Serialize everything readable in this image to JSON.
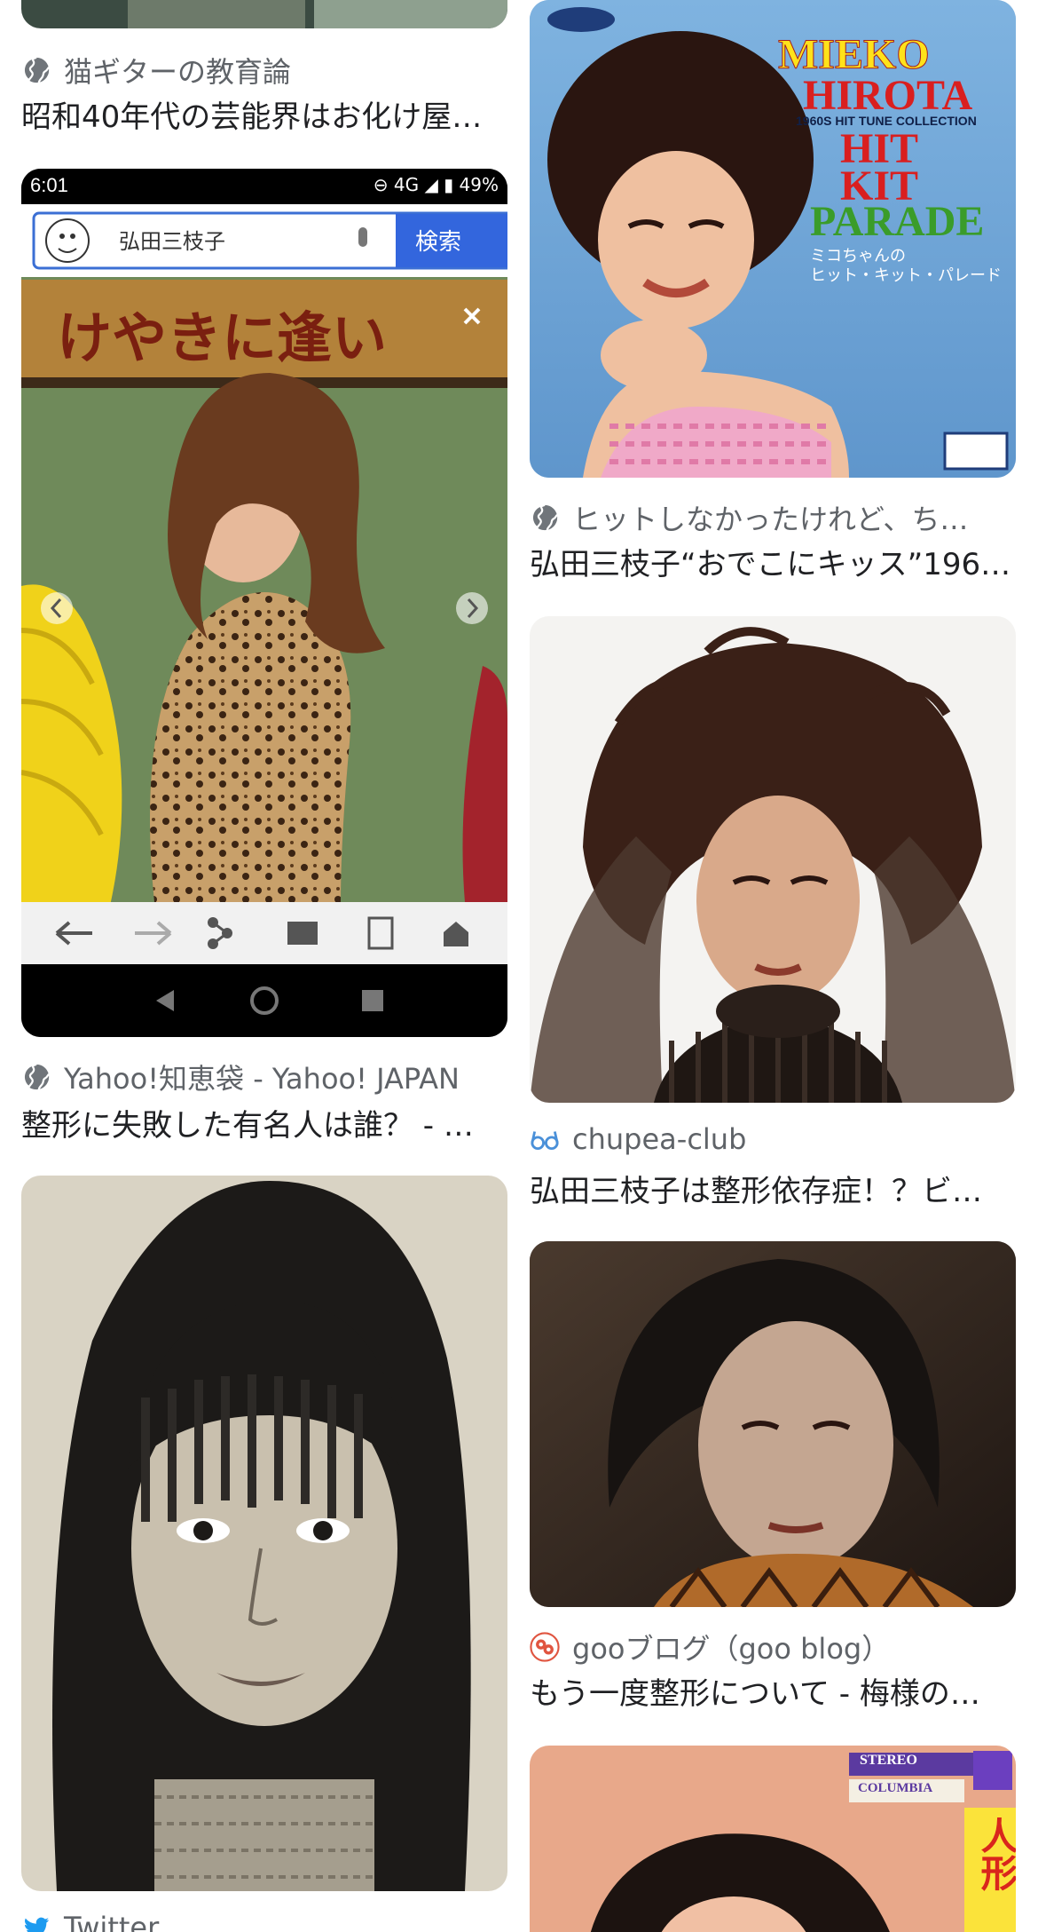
{
  "results": [
    {
      "source": "猫ギターの教育論",
      "title": "昭和40年代の芸能界はお化け屋…"
    },
    {
      "source": "Yahoo!知恵袋 - Yahoo! JAPAN",
      "title": "整形に失敗した有名人は誰？ - …",
      "embedded_ui": {
        "time": "6:01",
        "status_right": "⊖ 4G ◢ ▮ 49%",
        "search_query": "弘田三枝子",
        "search_button": "検索",
        "banner_text": "けやきに逢い"
      }
    },
    {
      "source": "Twitter",
      "title": ""
    },
    {
      "source": "ヒットしなかったけれど、ち…",
      "title": "弘田三枝子“おでこにキッス”196…",
      "album": {
        "line1": "MIEKO",
        "line2": "HIROTA",
        "line3": "1960S HIT TUNE COLLECTION",
        "line4": "HIT",
        "line5": "KIT",
        "line6": "PARADE",
        "sub1": "ミコちゃんの",
        "sub2": "ヒット・キット・パレード"
      }
    },
    {
      "source": "chupea-club",
      "title": "弘田三枝子は整形依存症！？ビ…"
    },
    {
      "source": "gooブログ（goo blog）",
      "title": "もう一度整形について - 梅様の…"
    },
    {
      "source": "",
      "title": "",
      "album": {
        "label1": "STEREO",
        "label2": "COLUMBIA",
        "title_vertical": "人形"
      }
    }
  ]
}
